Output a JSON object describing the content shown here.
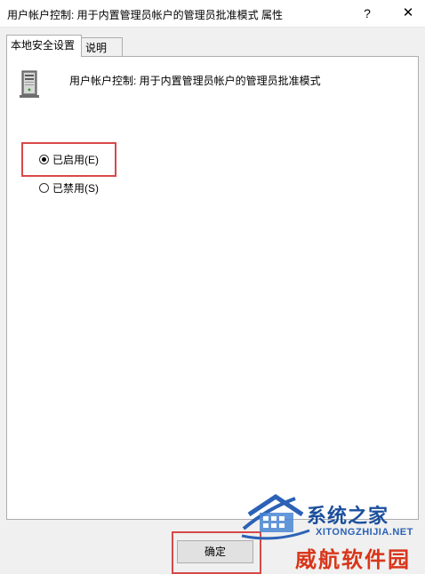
{
  "window": {
    "title": "用户帐户控制: 用于内置管理员帐户的管理员批准模式 属性",
    "help_label": "?",
    "close_label": "✕"
  },
  "tabs": [
    {
      "label": "本地安全设置",
      "active": true
    },
    {
      "label": "说明",
      "active": false
    }
  ],
  "policy": {
    "icon": "server-computer-icon",
    "name": "用户帐户控制: 用于内置管理员帐户的管理员批准模式"
  },
  "options": [
    {
      "label": "已启用(E)",
      "checked": true
    },
    {
      "label": "已禁用(S)",
      "checked": false
    }
  ],
  "buttons": {
    "ok_label": "确定"
  },
  "watermark": {
    "brand": "系统之家",
    "domain": "XITONGZHIJIA.NET",
    "red_text": "威航软件园"
  },
  "colors": {
    "highlight": "#d84848",
    "watermark_blue": "#1b4f9c",
    "watermark_red": "#d9361a"
  }
}
